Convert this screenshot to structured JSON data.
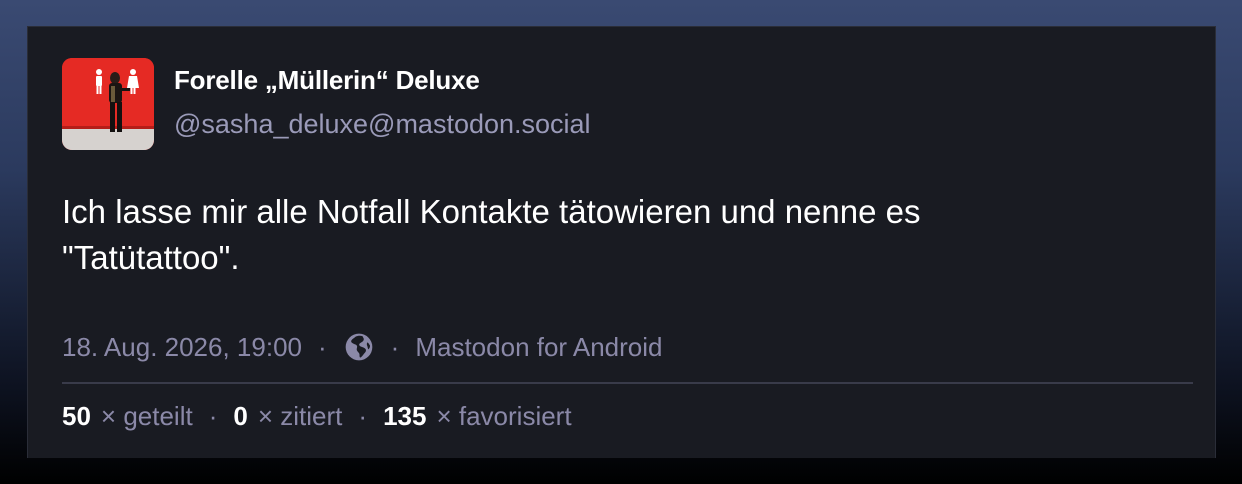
{
  "account": {
    "display_name": "Forelle „Müllerin“ Deluxe",
    "handle": "@sasha_deluxe@mastodon.social",
    "avatar_icon": "profile-photo"
  },
  "post": {
    "text_line1": "Ich lasse mir alle Notfall Kontakte tätowieren und nenne es",
    "text_line2": "\"Tatütattoo\"."
  },
  "meta": {
    "timestamp": "18. Aug. 2026, 19:00",
    "separator": "·",
    "visibility_icon": "globe-icon",
    "application": "Mastodon for Android"
  },
  "stats": {
    "boosts_count": "50",
    "boosts_label": "× geteilt",
    "quotes_count": "0",
    "quotes_label": "× zitiert",
    "favourites_count": "135",
    "favourites_label": "× favorisiert",
    "separator": "·"
  },
  "colors": {
    "card_bg": "#191b22",
    "secondary_text": "#8b89a8",
    "avatar_red": "#e52a24"
  }
}
